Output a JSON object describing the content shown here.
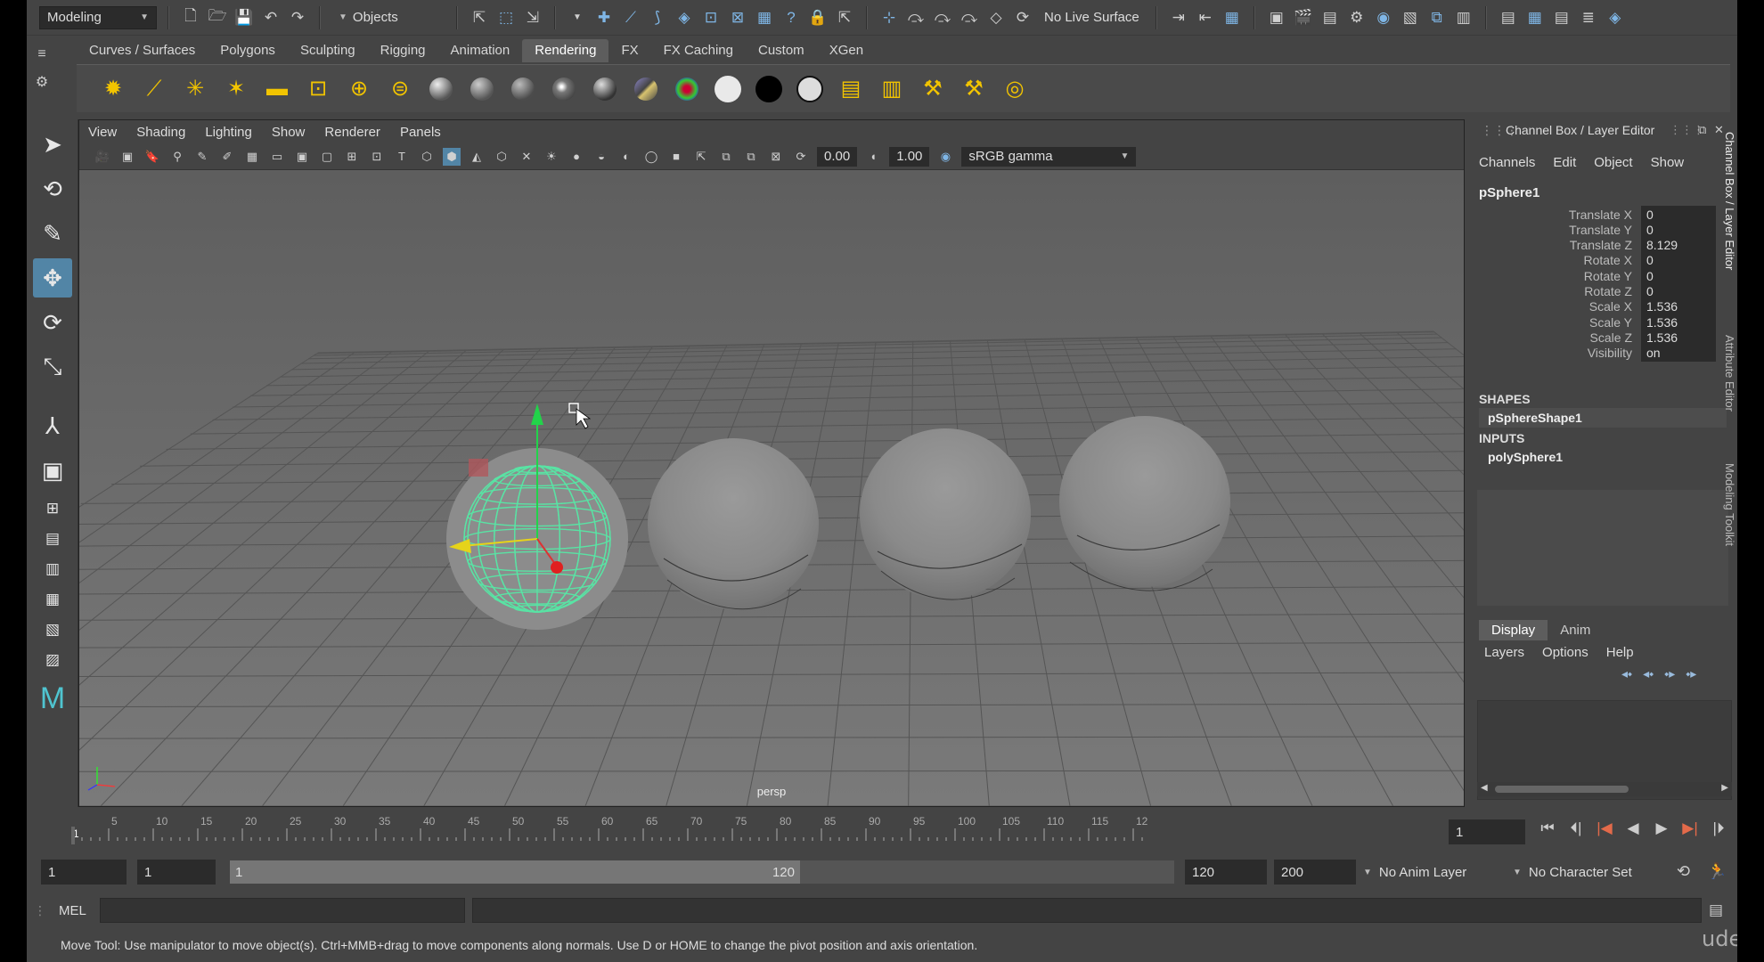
{
  "status_line": {
    "menu_set": "Modeling",
    "selection_mode": "Objects",
    "live_surface": "No Live Surface"
  },
  "shelf": {
    "tabs": [
      "Curves / Surfaces",
      "Polygons",
      "Sculpting",
      "Rigging",
      "Animation",
      "Rendering",
      "FX",
      "FX Caching",
      "Custom",
      "XGen"
    ],
    "active_tab": "Rendering"
  },
  "viewport": {
    "menu": [
      "View",
      "Shading",
      "Lighting",
      "Show",
      "Renderer",
      "Panels"
    ],
    "exposure": "0.00",
    "gamma": "1.00",
    "color_space": "sRGB gamma",
    "camera": "persp"
  },
  "channel_box": {
    "title": "Channel Box / Layer Editor",
    "menu": [
      "Channels",
      "Edit",
      "Object",
      "Show"
    ],
    "object": "pSphere1",
    "attributes": [
      {
        "name": "Translate X",
        "value": "0"
      },
      {
        "name": "Translate Y",
        "value": "0"
      },
      {
        "name": "Translate Z",
        "value": "8.129"
      },
      {
        "name": "Rotate X",
        "value": "0"
      },
      {
        "name": "Rotate Y",
        "value": "0"
      },
      {
        "name": "Rotate Z",
        "value": "0"
      },
      {
        "name": "Scale X",
        "value": "1.536"
      },
      {
        "name": "Scale Y",
        "value": "1.536"
      },
      {
        "name": "Scale Z",
        "value": "1.536"
      },
      {
        "name": "Visibility",
        "value": "on"
      }
    ],
    "shapes_label": "SHAPES",
    "shape": "pSphereShape1",
    "inputs_label": "INPUTS",
    "input": "polySphere1"
  },
  "layer_editor": {
    "tabs": [
      "Display",
      "Anim"
    ],
    "active_tab": "Display",
    "menu": [
      "Layers",
      "Options",
      "Help"
    ]
  },
  "side_tabs": [
    "Channel Box / Layer Editor",
    "Attribute Editor",
    "Modeling Toolkit"
  ],
  "time_slider": {
    "ticks": [
      "1",
      "5",
      "10",
      "15",
      "20",
      "25",
      "30",
      "35",
      "40",
      "45",
      "50",
      "55",
      "60",
      "65",
      "70",
      "75",
      "80",
      "85",
      "90",
      "95",
      "100",
      "105",
      "110",
      "115",
      "12"
    ],
    "current_frame": "1"
  },
  "range_slider": {
    "start": "1",
    "playback_start": "1",
    "handle_start": "1",
    "handle_end": "120",
    "playback_end": "120",
    "end": "200",
    "anim_layer": "No Anim Layer",
    "character_set": "No Character Set"
  },
  "command_line": {
    "label": "MEL"
  },
  "help_line": "Move Tool: Use manipulator to move object(s). Ctrl+MMB+drag to move components along normals. Use D or HOME to change the pivot position and axis orientation.",
  "watermark": "udemy",
  "colors": {
    "accent": "#5285a6",
    "wireframe": "#59e3a4",
    "viewport_bg": "#6b6b6b"
  }
}
